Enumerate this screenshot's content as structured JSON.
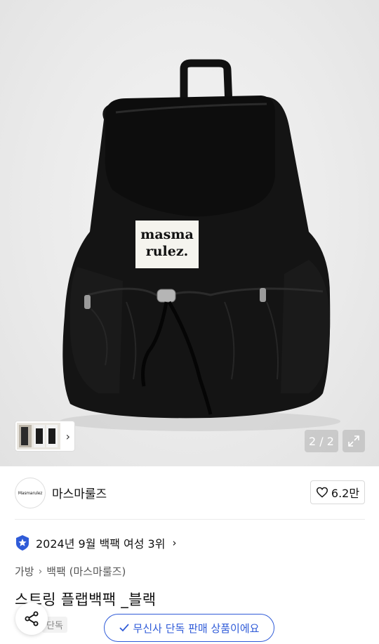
{
  "product_image": {
    "logo_line1": "masma",
    "logo_line2": "rulez.",
    "counter": "2 / 2"
  },
  "brand": {
    "logo_text": "Masmarulez",
    "name": "마스마룰즈",
    "likes": "6.2만"
  },
  "ranking": {
    "text": "2024년 9월 백팩 여성 3위"
  },
  "breadcrumb": {
    "category": "가방",
    "subcategory": "백팩 (마스마룰즈)"
  },
  "product": {
    "title": "스트링 플랩백팩 _블랙",
    "badge": "단독"
  },
  "exclusive": {
    "label": "무신사 단독 판매 상품이에요"
  },
  "colors": {
    "accent": "#2f5bd8",
    "rank_badge": "#2f5bd8"
  }
}
